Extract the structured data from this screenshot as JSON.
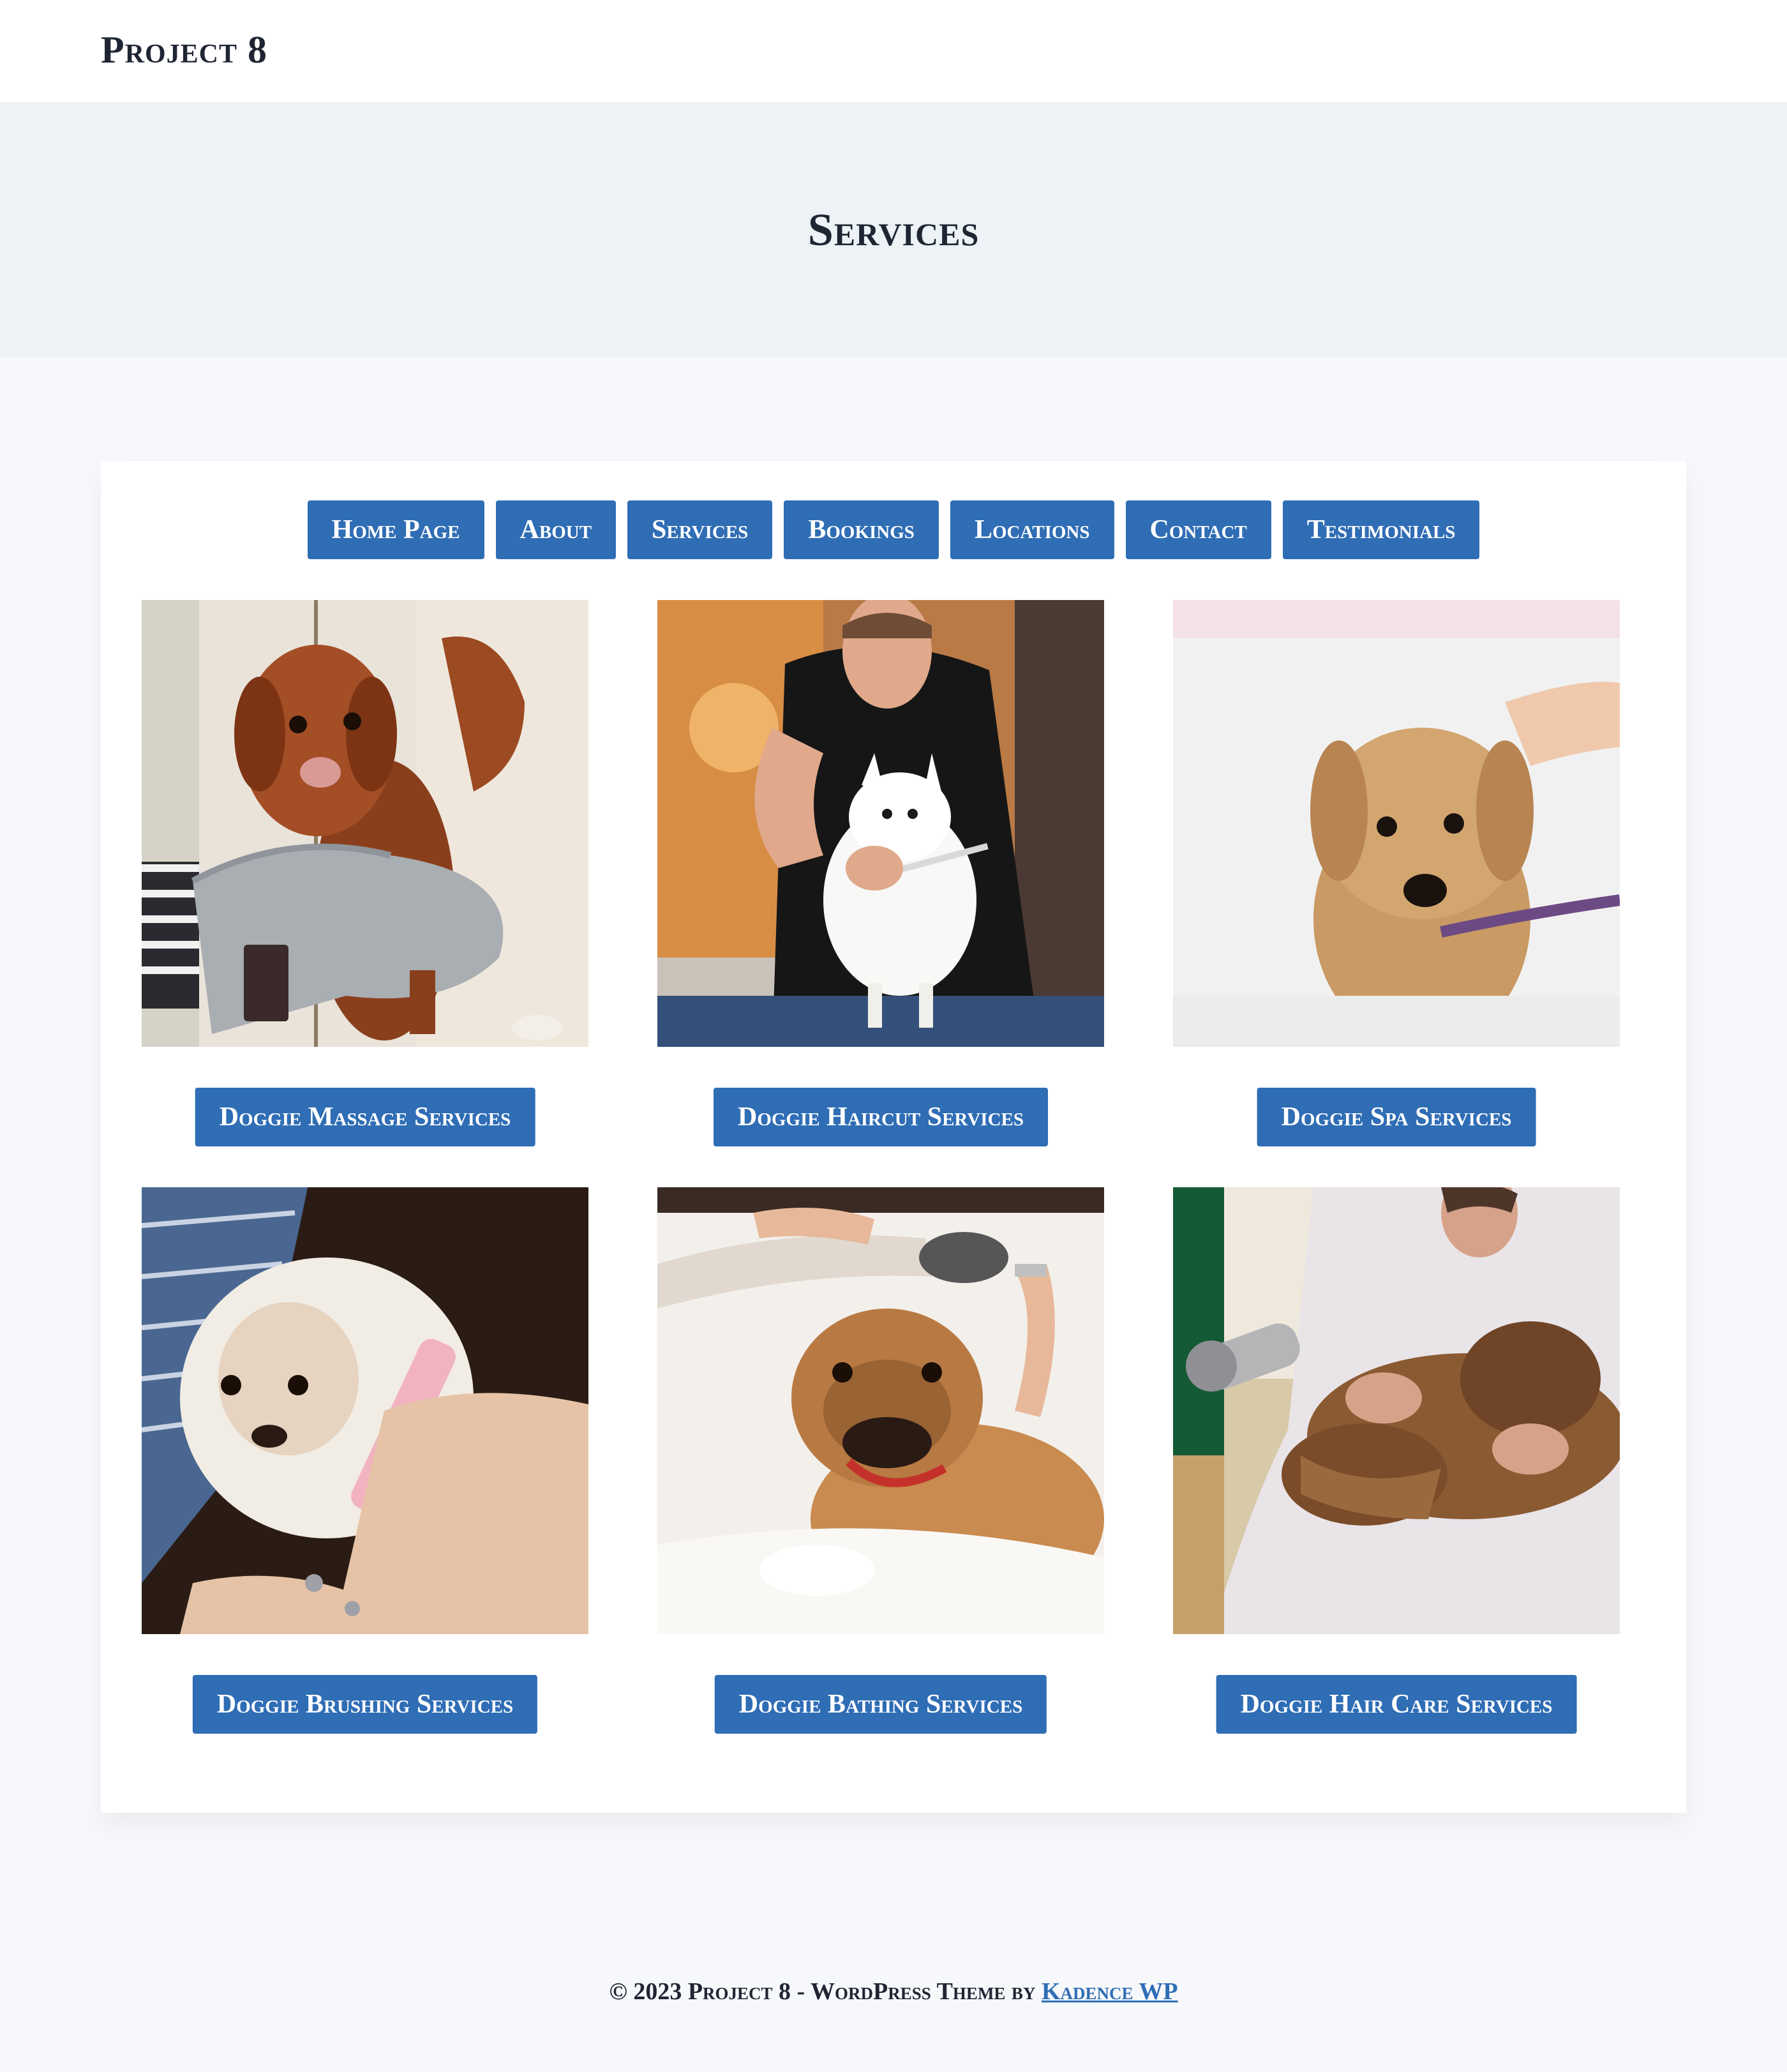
{
  "header": {
    "site_title": "Project 8"
  },
  "hero": {
    "title": "Services"
  },
  "nav": {
    "items": [
      {
        "label": "Home Page"
      },
      {
        "label": "About"
      },
      {
        "label": "Services"
      },
      {
        "label": "Bookings"
      },
      {
        "label": "Locations"
      },
      {
        "label": "Contact"
      },
      {
        "label": "Testimonials"
      }
    ]
  },
  "services": [
    {
      "label": "Doggie Massage Services",
      "image": "dog-paw-glove-photo"
    },
    {
      "label": "Doggie Haircut Services",
      "image": "groomer-combing-dog-photo"
    },
    {
      "label": "Doggie Spa Services",
      "image": "wet-terrier-photo"
    },
    {
      "label": "Doggie Brushing Services",
      "image": "fluffy-dog-brush-photo"
    },
    {
      "label": "Doggie Bathing Services",
      "image": "bulldog-bath-photo"
    },
    {
      "label": "Doggie Hair Care Services",
      "image": "blow-dry-dog-photo"
    }
  ],
  "footer": {
    "copyright": "© 2023 Project 8 - WordPress Theme by ",
    "link_label": "Kadence WP"
  },
  "colors": {
    "accent": "#2f6db5",
    "hero_bg": "#edf2f7",
    "page_bg": "#f6f8fb"
  }
}
